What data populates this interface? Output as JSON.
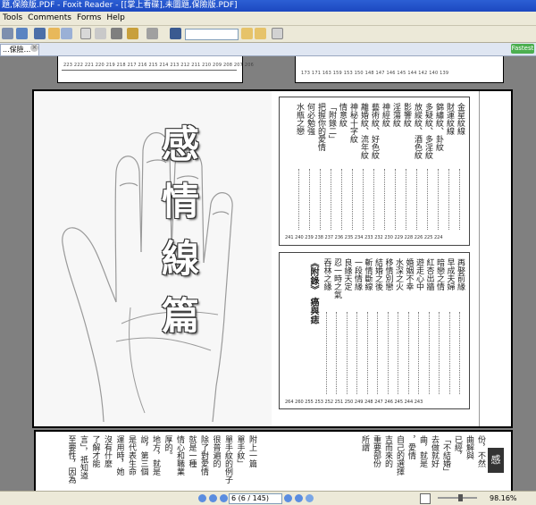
{
  "window": {
    "title": "題,保險版.PDF - Foxit Reader - [[掌上看碟],未圖題,保險版.PDF]"
  },
  "menu": {
    "items": [
      "Tools",
      "Comments",
      "Forms",
      "Help"
    ]
  },
  "tab": {
    "label": "...保險..."
  },
  "fastest_badge": "Fastest",
  "top_page": {
    "left_ticks": "223 222 221 220 219 218 217 216 215 214 213 212 211 210 209 208 207 206",
    "right_ticks": "173 171 163 159 153 150 148    147 146 145 144 142    140 139"
  },
  "left_page": {
    "title_chars": [
      "感",
      "情",
      "線",
      "篇"
    ]
  },
  "toc_upper": {
    "entries": [
      "金星紋線",
      "財運紋線",
      "錦繡紋、卦紋",
      "多疑紋、多淫紋",
      "放縱紋、酒色紋",
      "影響紋",
      "淫蕩紋",
      "神經紋",
      "藝術紋、好色紋",
      "離婚紋、流年紋",
      "神秘十字紋",
      "情意紋",
      "「附錄二」",
      "把握你的愛情",
      "何必勉強",
      "水瓶之戀"
    ],
    "page_numbers": "241 240 239 238 237 236 235 234 233 232 230 229 228 226 225 224"
  },
  "toc_lower": {
    "entries": [
      "再娶前緣",
      "早成夫婦",
      "暗戀之情",
      "紅杏出牆",
      "遊走心中",
      "婚姻不幸",
      "水深之火",
      "移情別戀",
      "結婚之後",
      "斬情斷線",
      "一段情緣",
      "良緣天定",
      "忍一時之氣",
      "吞林之緣"
    ],
    "appendix": "《附錄》 癌與痣",
    "page_numbers": "264 260 255 253 252 251 250 249 248 247 246 245 244 243",
    "appendix_page": "256"
  },
  "bottom_page": {
    "columns": [
      "附上一篇",
      "單手紋」",
      "單手紋的例子",
      "很普遍的",
      "除了對愛情",
      "就是一種",
      "情心和職業",
      "厚的。",
      "地方，就是",
      "說，第三個",
      "是代表生命",
      "運用時，她",
      "沒有什麼",
      "了解才能",
      "言」，祇知道",
      "至要性，因為"
    ],
    "right_columns": [
      "份，不然",
      "曲解與",
      "已經，",
      "「不結婚」",
      "去做就好",
      "曲，就是",
      "，愛情",
      "自己的選擇",
      "吉而來的",
      "重要部份",
      "所謂"
    ],
    "side_tab": "感"
  },
  "status": {
    "page_field": "6 (6 / 145)",
    "zoom": "98.16%"
  },
  "colors": {
    "titlebar": "#2c5fd4",
    "chrome": "#ece9d8",
    "doc_background": "#808080",
    "fastest": "#4caf50"
  }
}
